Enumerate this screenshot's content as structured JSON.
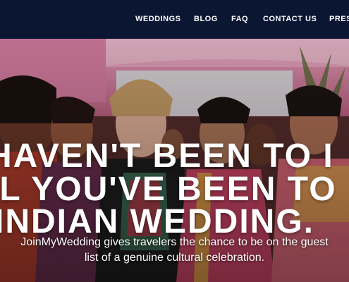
{
  "nav": {
    "items": [
      "WEDDINGS",
      "BLOG",
      "FAQ",
      "CONTACT US",
      "PRES"
    ]
  },
  "hero": {
    "headline": {
      "line1": "HAVEN'T BEEN TO I",
      "line2": "IL YOU'VE BEEN TO",
      "line3": "INDIAN WEDDING."
    },
    "subtitle": {
      "line1": "JoinMyWedding gives travelers the chance to be on the guest",
      "line2": "list of a genuine cultural celebration."
    }
  },
  "colors": {
    "nav_bg": "#0b1633",
    "tent_pink": "#d77a9a",
    "text": "#ffffff"
  }
}
